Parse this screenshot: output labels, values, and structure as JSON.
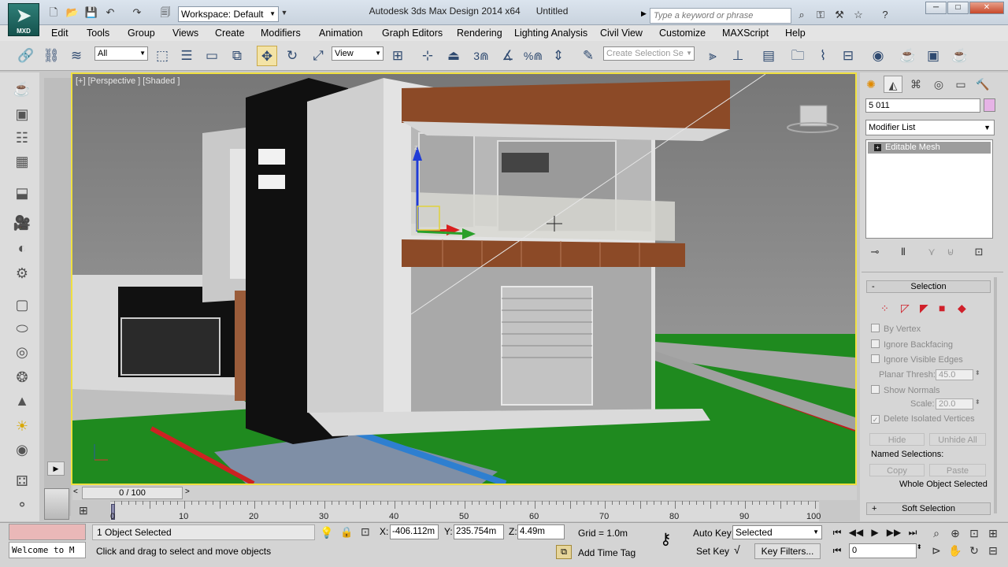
{
  "app": {
    "logo_label": "MXD",
    "workspace": "Workspace: Default",
    "title": "Autodesk 3ds Max Design 2014 x64",
    "file": "Untitled",
    "search_placeholder": "Type a keyword or phrase"
  },
  "menu": [
    "Edit",
    "Tools",
    "Group",
    "Views",
    "Create",
    "Modifiers",
    "Animation",
    "Graph Editors",
    "Rendering",
    "Lighting Analysis",
    "Civil View",
    "Customize",
    "MAXScript",
    "Help"
  ],
  "toolbar": {
    "selection_filter": "All",
    "ref_coord": "View",
    "named_selection_placeholder": "Create Selection Se",
    "snap_label": "3",
    "angle_snap_label": "%"
  },
  "viewport": {
    "label": "[+] [Perspective ] [Shaded ]",
    "axis_z": "z"
  },
  "command_panel": {
    "object_name": "5    011",
    "modifier_list": "Modifier List",
    "stack_item": "Editable Mesh",
    "rollout_selection": "Selection",
    "by_vertex": "By Vertex",
    "ignore_backfacing": "Ignore Backfacing",
    "ignore_visible_edges": "Ignore Visible Edges",
    "planar_thresh_label": "Planar Thresh:",
    "planar_thresh_value": "45.0",
    "show_normals": "Show Normals",
    "scale_label": "Scale:",
    "scale_value": "20.0",
    "delete_isolated": "Delete Isolated Vertices",
    "hide": "Hide",
    "unhide_all": "Unhide All",
    "named_selections": "Named Selections:",
    "copy": "Copy",
    "paste": "Paste",
    "whole_object_selected": "Whole Object Selected",
    "rollout_soft": "Soft Selection"
  },
  "timeline": {
    "slider": "0 / 100",
    "labels": [
      "0",
      "10",
      "20",
      "30",
      "40",
      "50",
      "60",
      "70",
      "80",
      "90",
      "100"
    ]
  },
  "status": {
    "maxscript_text": "Welcome to M",
    "objects_selected": "1 Object Selected",
    "prompt": "Click and drag to select and move objects",
    "x_label": "X:",
    "x_value": "-406.112m",
    "y_label": "Y:",
    "y_value": "235.754m",
    "z_label": "Z:",
    "z_value": "4.49m",
    "grid": "Grid = 1.0m",
    "add_time_tag": "Add Time Tag",
    "auto_key": "Auto Key",
    "set_key": "Set Key",
    "key_mode": "Selected",
    "key_filters": "Key Filters...",
    "frame": "0"
  }
}
